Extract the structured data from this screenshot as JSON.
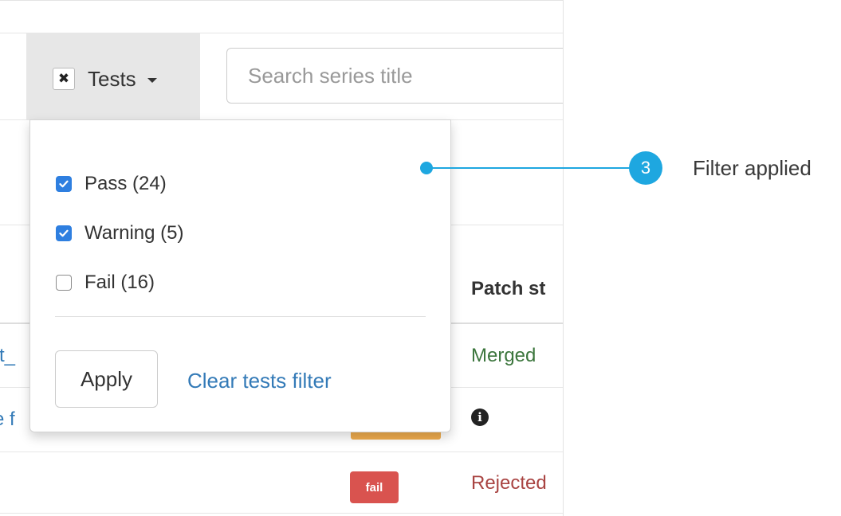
{
  "toolbar": {
    "tests_clear_glyph": "✖",
    "tests_label": "Tests",
    "search_placeholder": "Search series title"
  },
  "table": {
    "column_header": "Patch st",
    "rows": [
      {
        "link_fragment": "t_",
        "status": "Merged",
        "status_color": "#3c763d"
      },
      {
        "link_fragment": "e f",
        "status_icon": "info-circle-icon",
        "badge_color": "#f0ad4e"
      },
      {
        "badge": "fail",
        "badge_color": "#d9534f",
        "status": "Rejected",
        "status_color": "#a94442"
      }
    ]
  },
  "dropdown": {
    "options": [
      {
        "label": "Pass (24)",
        "checked": true
      },
      {
        "label": "Warning (5)",
        "checked": true
      },
      {
        "label": "Fail (16)",
        "checked": false
      }
    ],
    "apply_label": "Apply",
    "clear_label": "Clear tests filter"
  },
  "callout": {
    "number": "3",
    "text": "Filter applied",
    "color": "#1ea7e0"
  },
  "colors": {
    "accent": "#2e7fe0",
    "link": "#337ab7"
  }
}
